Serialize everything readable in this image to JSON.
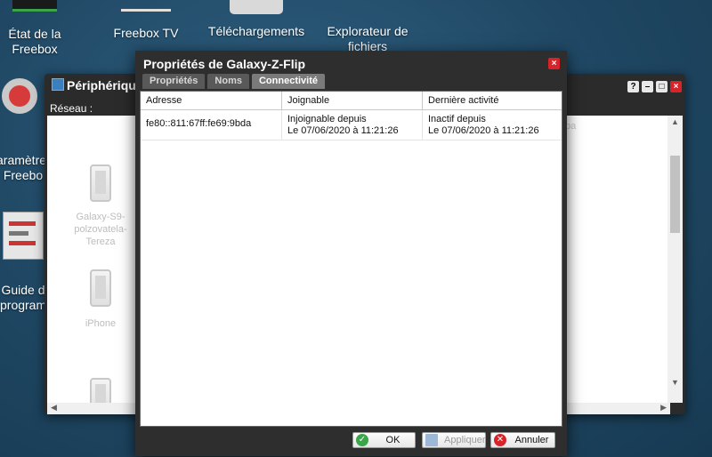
{
  "desktop": {
    "icons": [
      {
        "label": "État de la Freebox"
      },
      {
        "label": "Freebox TV"
      },
      {
        "label": "Téléchargements"
      },
      {
        "label": "Explorateur de fichiers"
      },
      {
        "label": "aramètres Freebo"
      },
      {
        "label": "Guide d programm"
      }
    ]
  },
  "bg_window": {
    "title": "Périphériques",
    "toolbar_label": "Réseau :",
    "devices": [
      {
        "name": "Galaxy-S9-polzovatela-Tereza"
      },
      {
        "name": "iPhone"
      },
      {
        "name": ""
      }
    ],
    "controls": {
      "help": "?",
      "minimize": "–",
      "maximize": "□",
      "close": "×"
    },
    "faint_text": "pa"
  },
  "dialog": {
    "title": "Propriétés de Galaxy-Z-Flip",
    "close": "×",
    "tabs": [
      {
        "label": "Propriétés",
        "active": false
      },
      {
        "label": "Noms",
        "active": false
      },
      {
        "label": "Connectivité",
        "active": true
      }
    ],
    "table": {
      "headers": [
        "Adresse",
        "Joignable",
        "Dernière activité"
      ],
      "rows": [
        {
          "address": "fe80::811:67ff:fe69:9bda",
          "reachable_line1": "Injoignable depuis",
          "reachable_line2": "Le 07/06/2020 à 11:21:26",
          "activity_line1": "Inactif depuis",
          "activity_line2": "Le 07/06/2020 à 11:21:26"
        }
      ]
    },
    "buttons": {
      "ok": "OK",
      "apply": "Appliquer",
      "cancel": "Annuler"
    }
  },
  "colors": {
    "accent_green": "#3ba54a",
    "accent_red": "#d8232a",
    "dialog_bg": "#2e2e2e"
  }
}
